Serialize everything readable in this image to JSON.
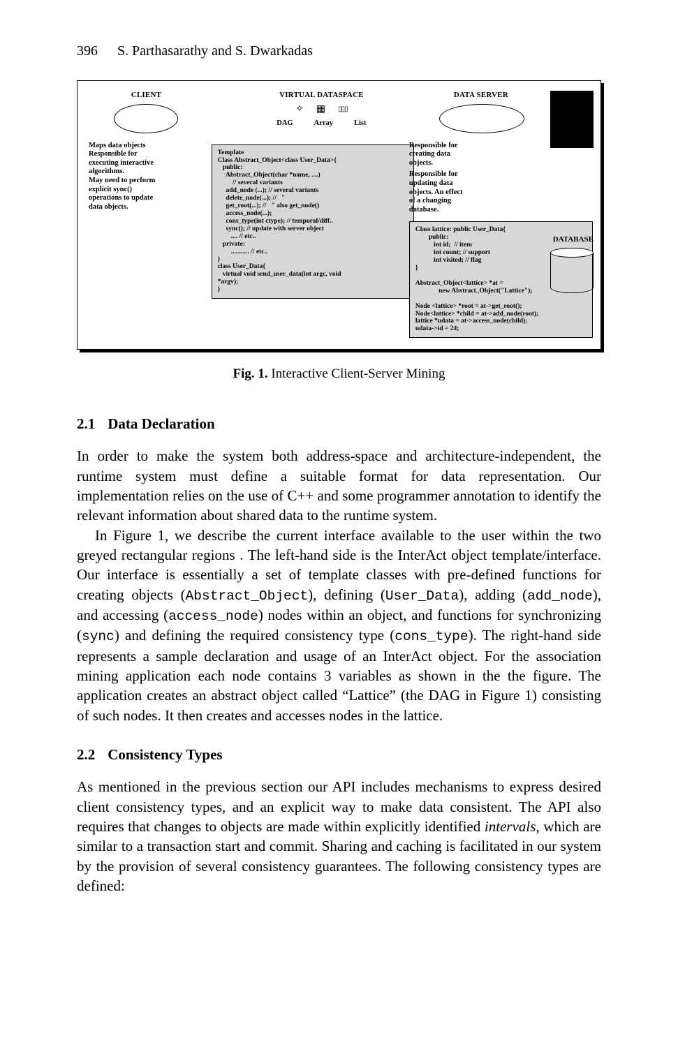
{
  "header": {
    "page_number": "396",
    "authors": "S. Parthasarathy and S. Dwarkadas"
  },
  "figure": {
    "client_title": "CLIENT",
    "virtual_title": "VIRTUAL DATASPACE",
    "server_title": "DATA SERVER",
    "sub_labels": {
      "dag": "DAG",
      "array": "Array",
      "list": "List"
    },
    "left_bullets": "Maps data objects\nResponsible for\nexecuting interactive\nalgorithms.\nMay need to perform\nexplicit sync()\noperations to update\ndata objects.",
    "right_bullets_a": "Responsible for\ncreating data\nobjects.",
    "right_bullets_b": "Responsible for\nupdating data\nobjects. An effect\nof a changing\ndatabase.",
    "db_label": "DATABASE",
    "code_left": "Template\nClass Abstract_Object<class User_Data>{\n   public:\n     Abstract_Object(char *name, ....)\n         // several variants\n     add_node (...); // several variants\n     delete_node(...); //   \"\n     get_root(...); //   \" also get_node()\n     access_node(...);\n     cons_type(int ctype); // temporal/diff..\n     sync(); // update with server object\n        .... // etc..\n   private:\n        ........... // etc..\n}\nclass User_Data{\n   virtual void send_user_data(int argc, void\n*argv);\n}",
    "code_right": "Class lattice: public User_Data{\n        public:\n           int id;  // item\n           int count; // support\n           int visited; // flag\n}\n\nAbstract_Object<lattice> *at =\n              new Abstract_Object(\"Lattice\");\n\nNode <lattice> *root = at->get_root();\nNode<lattice> *child = at->add_node(root);\nlattice *udata = at->access_node(child);\nudata->id = 24;",
    "caption_bold": "Fig. 1.",
    "caption_text": " Interactive Client-Server Mining"
  },
  "sections": {
    "s21": {
      "num": "2.1",
      "title": "Data Declaration"
    },
    "s22": {
      "num": "2.2",
      "title": "Consistency Types"
    }
  },
  "paragraphs": {
    "p1": "In order to make the system both address-space and architecture-independent, the runtime system must define a suitable format for data representation. Our implementation relies on the use of C++ and some programmer annotation to identify the relevant information about shared data to the runtime system.",
    "p2a": "In Figure 1, we describe the current interface available to the user within the two greyed rectangular regions . The left-hand side is the InterAct object template/interface. Our interface is essentially a set of template classes with pre-defined functions for creating objects (",
    "p2b": "), defining (",
    "p2c": "), adding (",
    "p2d": "), and accessing (",
    "p2e": ") nodes within an object, and functions for synchronizing (",
    "p2f": ") and defining the required consistency type (",
    "p2g": "). The right-hand side represents a sample declaration and usage of an InterAct object. For the association mining application each node contains 3 variables as shown in the the figure. The application creates an abstract object called “Lattice” (the DAG in Figure 1) consisting of such nodes. It then creates and accesses nodes in the lattice.",
    "code": {
      "abstract_object": "Abstract_Object",
      "user_data": "User_Data",
      "add_node": "add_node",
      "access_node": "access_node",
      "sync": "sync",
      "cons_type": "cons_type"
    },
    "p3a": "As mentioned in the previous section our API includes mechanisms to express desired client consistency types, and an explicit way to make data consistent. The API also requires that changes to objects are made within explicitly identified ",
    "p3_ital": "intervals",
    "p3b": ", which are similar to a transaction start and commit. Sharing and caching is facilitated in our system by the provision of several consistency guarantees. The following consistency types are defined:"
  }
}
